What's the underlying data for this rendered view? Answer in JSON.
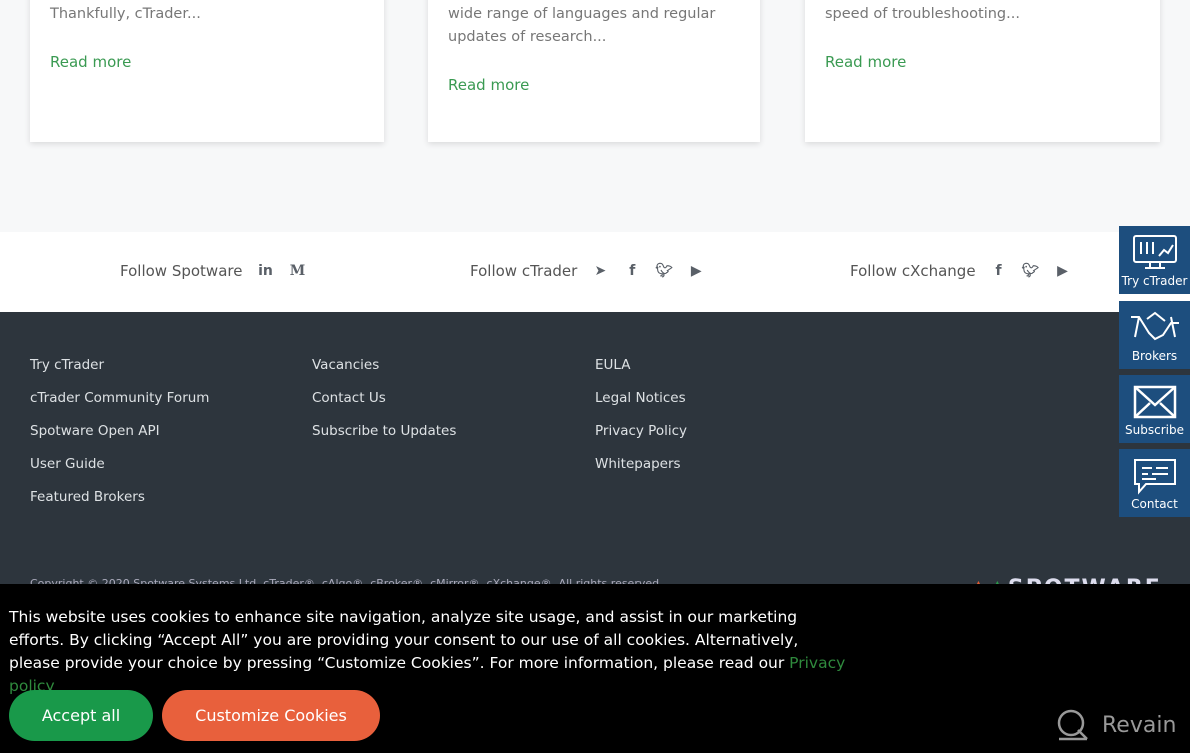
{
  "cards": [
    {
      "text": "Thankfully, cTrader...",
      "link": "Read more"
    },
    {
      "text": "wide range of languages and regular updates of research...",
      "link": "Read more"
    },
    {
      "text": "speed of troubleshooting...",
      "link": "Read more"
    }
  ],
  "follow": [
    {
      "label": "Follow Spotware",
      "icons": [
        "linkedin-icon",
        "medium-icon"
      ]
    },
    {
      "label": "Follow cTrader",
      "icons": [
        "telegram-icon",
        "facebook-icon",
        "twitter-icon",
        "youtube-icon"
      ]
    },
    {
      "label": "Follow cXchange",
      "icons": [
        "facebook-icon",
        "twitter-icon",
        "youtube-icon"
      ]
    }
  ],
  "footer": {
    "col1": [
      "Try cTrader",
      "cTrader Community Forum",
      "Spotware Open API",
      "User Guide",
      "Featured Brokers"
    ],
    "col2": [
      "Vacancies",
      "Contact Us",
      "Subscribe to Updates"
    ],
    "col3": [
      "EULA",
      "Legal Notices",
      "Privacy Policy",
      "Whitepapers"
    ],
    "copyright": "Copyright © 2020 Spotware Systems Ltd. cTrader®, cAlgo®, cBroker®, cMirror®, cXchange®. All rights reserved.",
    "logo": "SPOTWARE"
  },
  "side": [
    "Try cTrader",
    "Brokers",
    "Subscribe",
    "Contact"
  ],
  "cookie": {
    "text": "This website uses cookies to enhance site navigation, analyze site usage, and assist in our marketing efforts. By clicking “Accept All” you are providing your consent to our use of all cookies. Alternatively, please provide your choice by pressing “Customize Cookies”. For more information, please read our ",
    "link": "Privacy policy",
    "accept": "Accept all",
    "customize": "Customize Cookies",
    "accept_color": "#19994a",
    "customize_color": "#e8603c"
  },
  "watermark": "Revain"
}
